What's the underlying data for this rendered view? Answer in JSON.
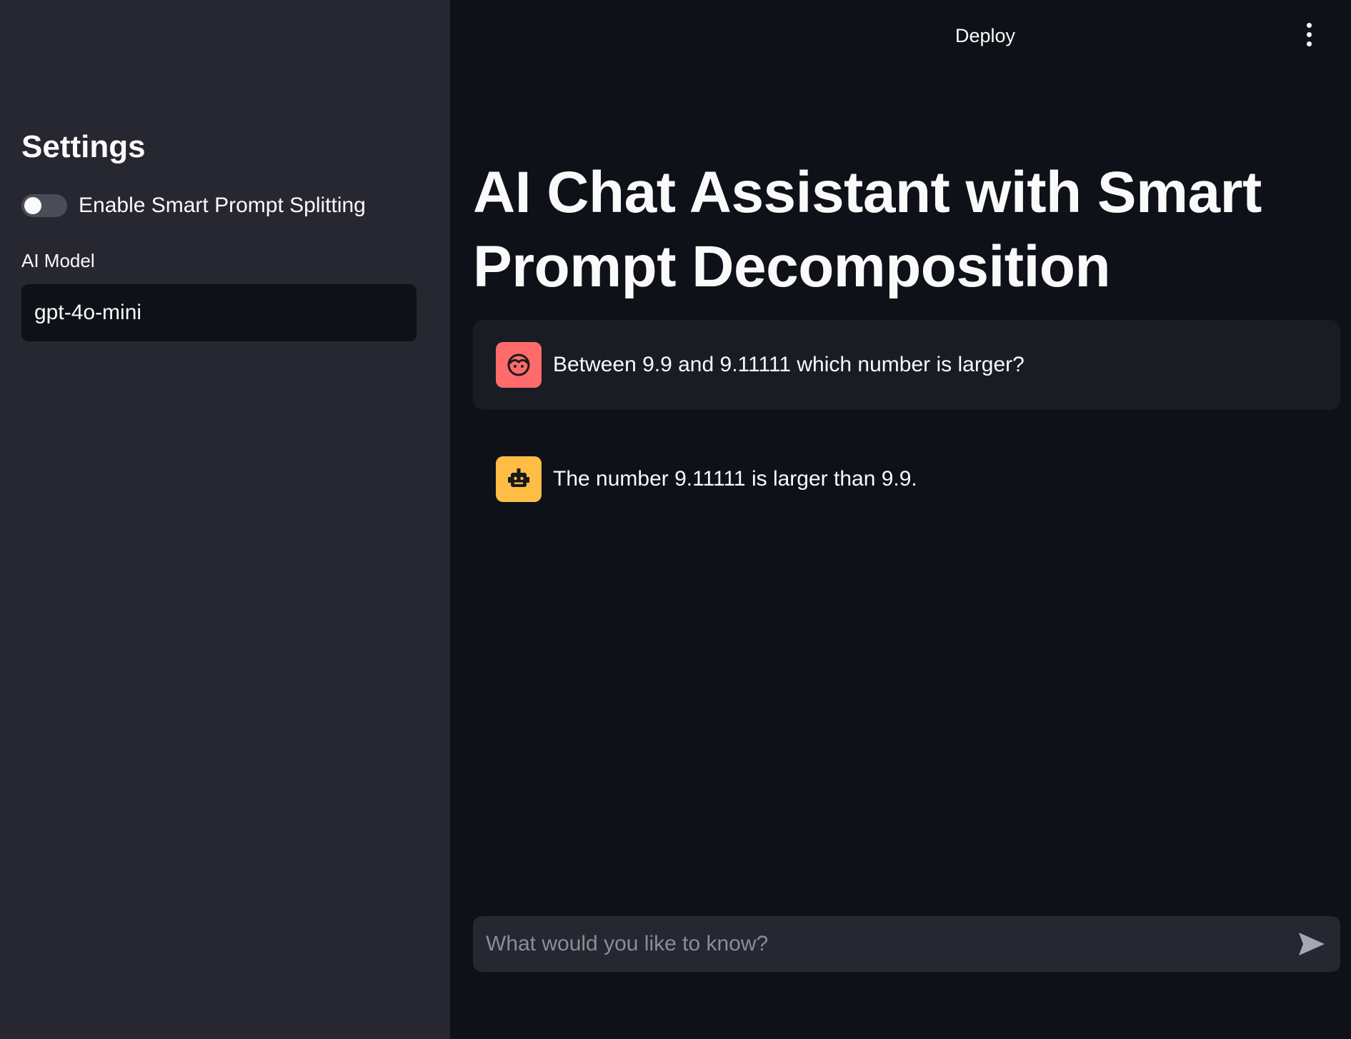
{
  "header": {
    "deploy_label": "Deploy",
    "menu_icon": "kebab-menu-icon"
  },
  "sidebar": {
    "title": "Settings",
    "toggle": {
      "label": "Enable Smart Prompt Splitting",
      "enabled": false
    },
    "model": {
      "label": "AI Model",
      "selected": "gpt-4o-mini"
    }
  },
  "main": {
    "title": "AI Chat Assistant with Smart Prompt Decomposition",
    "messages": [
      {
        "role": "user",
        "avatar_icon": "user-face-icon",
        "avatar_color": "#ff6b6b",
        "text": "Between 9.9 and 9.11111 which number is larger?"
      },
      {
        "role": "assistant",
        "avatar_icon": "robot-icon",
        "avatar_color": "#ffbd45",
        "text": "The number 9.11111 is larger than 9.9."
      }
    ],
    "chat_input": {
      "placeholder": "What would you like to know?",
      "value": ""
    }
  },
  "colors": {
    "sidebar_bg": "#262730",
    "main_bg": "#0e1117",
    "text": "#fafafa"
  }
}
